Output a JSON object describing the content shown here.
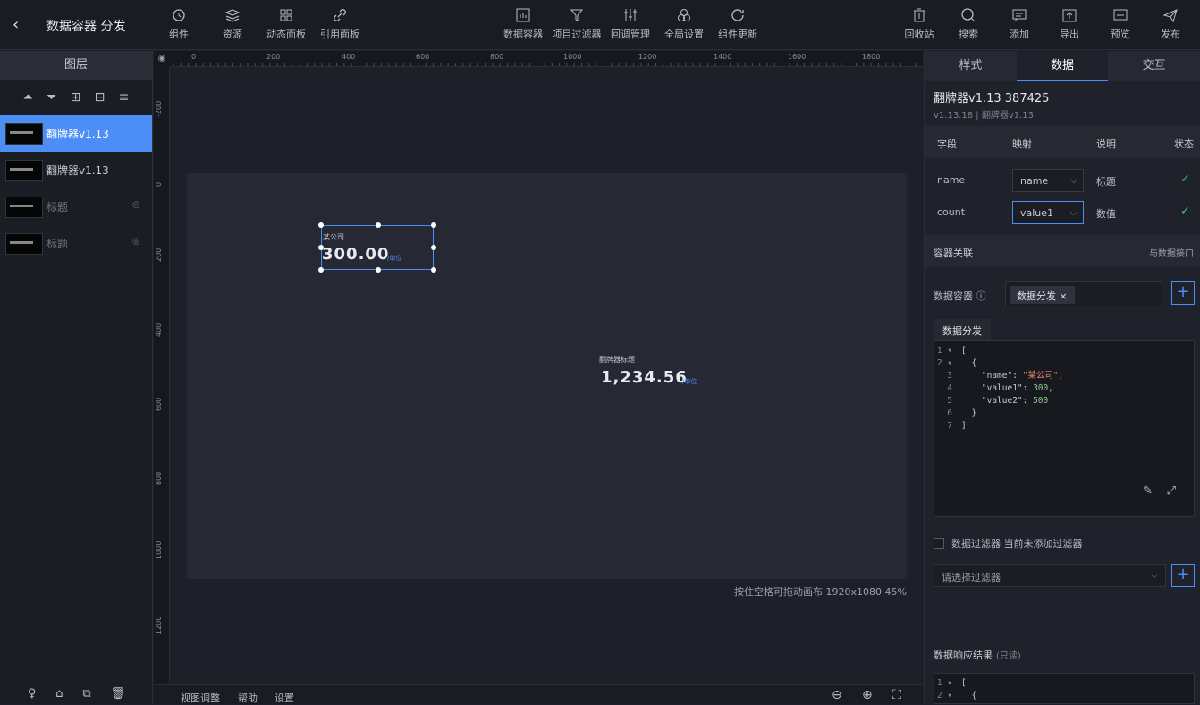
{
  "header": {
    "back_icon": "chevron-left-icon",
    "title": "数据容器 分发",
    "left_tools": [
      {
        "label": "组件",
        "icon": "component-icon"
      },
      {
        "label": "资源",
        "icon": "layers-icon"
      },
      {
        "label": "动态面板",
        "icon": "grid-icon"
      },
      {
        "label": "引用面板",
        "icon": "link-icon"
      }
    ],
    "center_tools": [
      {
        "label": "数据容器",
        "icon": "data-container-icon"
      },
      {
        "label": "项目过滤器",
        "icon": "filter-icon"
      },
      {
        "label": "回调管理",
        "icon": "sliders-icon"
      },
      {
        "label": "全局设置",
        "icon": "settings-circles-icon"
      },
      {
        "label": "组件更新",
        "icon": "refresh-icon"
      }
    ],
    "right_tools": [
      {
        "label": "回收站",
        "icon": "trash-icon"
      },
      {
        "label": "搜索",
        "icon": "search-icon"
      },
      {
        "label": "添加",
        "icon": "comment-icon"
      },
      {
        "label": "导出",
        "icon": "export-icon"
      },
      {
        "label": "预览",
        "icon": "preview-icon"
      },
      {
        "label": "发布",
        "icon": "send-icon"
      }
    ]
  },
  "layers": {
    "title": "图层",
    "align_icons": [
      "align-top-icon",
      "align-middle-icon",
      "align-vertical-icon",
      "align-horizontal-icon",
      "align-left-icon"
    ],
    "items": [
      {
        "name": "翻牌器v1.13",
        "active": true,
        "hidden": false
      },
      {
        "name": "翻牌器v1.13",
        "active": false,
        "hidden": false
      },
      {
        "name": "标题",
        "active": false,
        "hidden": true
      },
      {
        "name": "标题",
        "active": false,
        "hidden": true
      }
    ],
    "footer_icons": [
      "lightbulb-icon",
      "lock-icon",
      "copy-icon",
      "delete-icon"
    ]
  },
  "canvas": {
    "ruler_h": [
      "0",
      "200",
      "400",
      "600",
      "800",
      "1000",
      "1200",
      "1400",
      "1600",
      "1800"
    ],
    "ruler_v": [
      "-200",
      "0",
      "200",
      "400",
      "600",
      "800",
      "1000",
      "1200"
    ],
    "widget1": {
      "label": "某公司",
      "value": "300.00",
      "unit": "/单位"
    },
    "widget2": {
      "label": "翻牌器标题",
      "value": "1,234.56",
      "unit": "/单位"
    },
    "info": "按住空格可拖动画布   1920x1080 45%"
  },
  "bottombar": {
    "items": [
      "视图调整",
      "帮助",
      "设置"
    ],
    "icons": [
      "zoom-out-icon",
      "zoom-in-icon",
      "fit-icon"
    ]
  },
  "panel": {
    "tabs": [
      "样式",
      "数据",
      "交互"
    ],
    "active_tab": 1,
    "component_name": "翻牌器v1.13 387425",
    "component_version": "v1.13.18 | 翻牌器v1.13",
    "field_headers": [
      "字段",
      "映射",
      "说明",
      "状态"
    ],
    "fields": [
      {
        "field": "name",
        "mapping": "name",
        "desc": "标题",
        "status": "✓"
      },
      {
        "field": "count",
        "mapping": "value1",
        "desc": "数值",
        "status": "✓"
      }
    ],
    "container_section": "容器关联",
    "container_link": "与数据接口",
    "container_label": "数据容器 ⓘ",
    "container_tag": "数据分发 ×",
    "code_tab": "数据分发",
    "code_lines": [
      {
        "n": "1 ▾",
        "t": "["
      },
      {
        "n": "2 ▾",
        "t": "  {"
      },
      {
        "n": "3",
        "t": "    \"name\": \"某公司\","
      },
      {
        "n": "4",
        "t": "    \"value1\": 300,"
      },
      {
        "n": "5",
        "t": "    \"value2\": 500"
      },
      {
        "n": "6",
        "t": "  }"
      },
      {
        "n": "7",
        "t": "]"
      }
    ],
    "filter_label": "数据过滤器   当前未添加过滤器",
    "filter_placeholder": "请选择过滤器",
    "response_title": "数据响应结果",
    "response_readonly": "(只读)",
    "response_lines": [
      {
        "n": "1 ▾",
        "t": "["
      },
      {
        "n": "2 ▾",
        "t": "  {"
      }
    ]
  },
  "colors": {
    "accent": "#4c8df6",
    "ok": "#3fbf6f"
  }
}
